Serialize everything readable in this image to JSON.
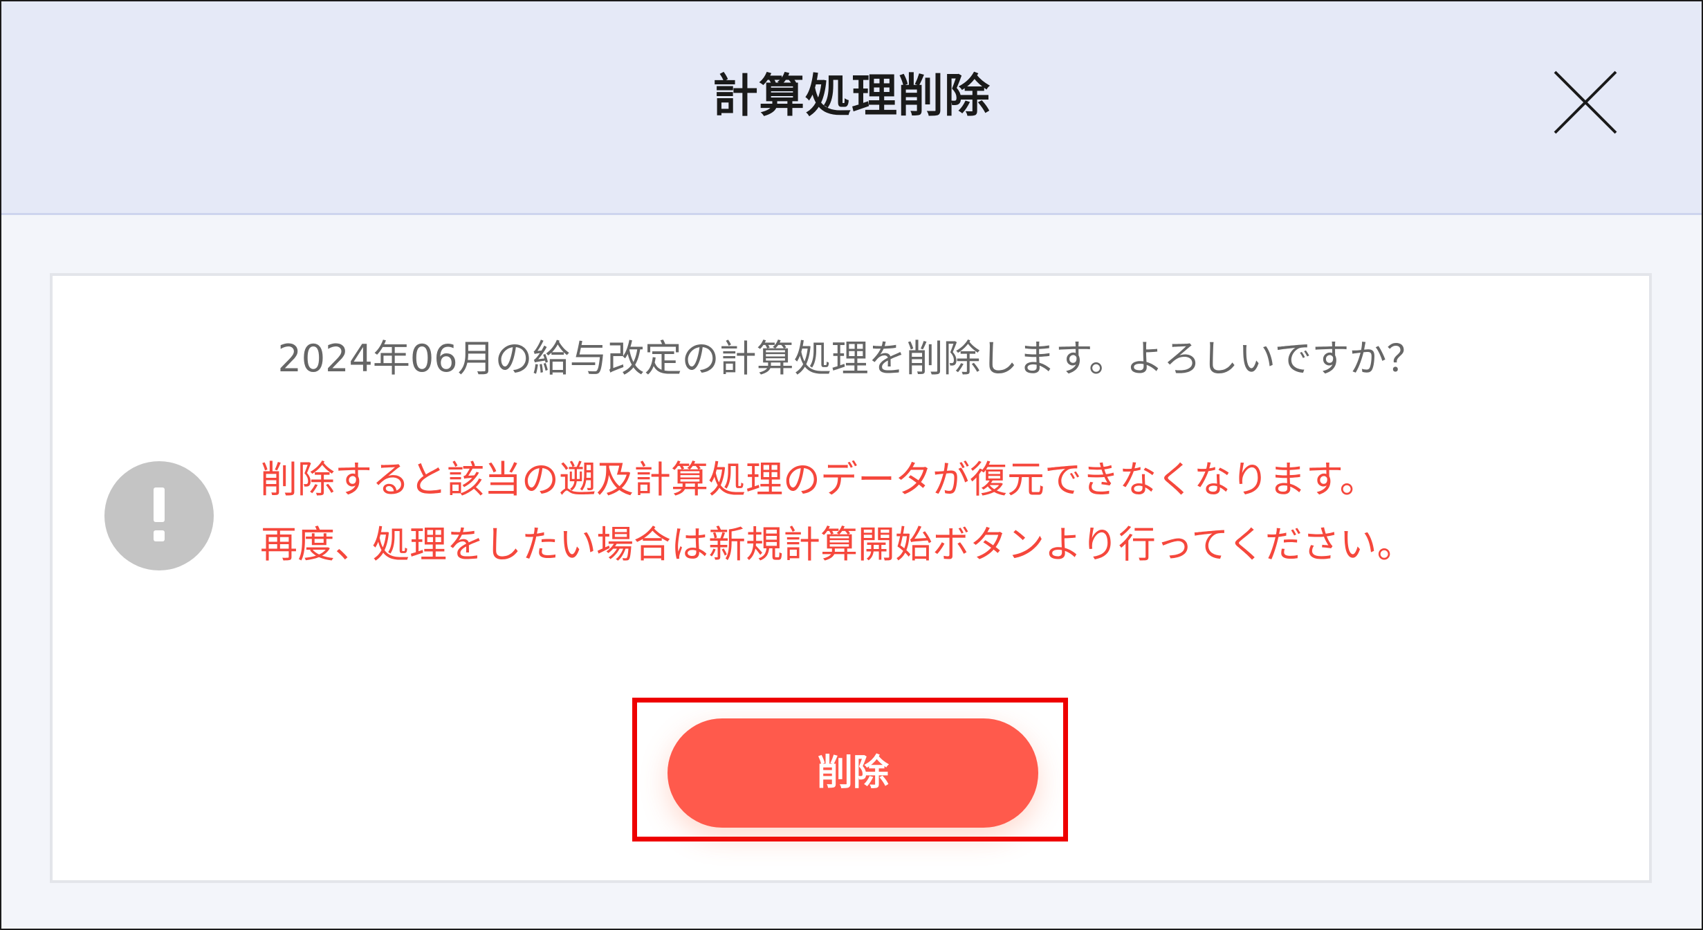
{
  "dialog": {
    "title": "計算処理削除",
    "close_icon": "close-icon",
    "confirm_message": "2024年06月の給与改定の計算処理を削除します。よろしいですか？",
    "warning_icon": "exclamation-circle-icon",
    "warning_lines": [
      "削除すると該当の遡及計算処理のデータが復元できなくなります。",
      "再度、処理をしたい場合は新規計算開始ボタンより行ってください。"
    ],
    "delete_button_label": "削除"
  },
  "colors": {
    "header_bg": "#e5e9f7",
    "body_bg": "#f3f5fa",
    "warning_text": "#f5473c",
    "delete_button": "#ff5a4c",
    "highlight_border": "#ee0000",
    "warning_icon": "#c4c4c4"
  }
}
